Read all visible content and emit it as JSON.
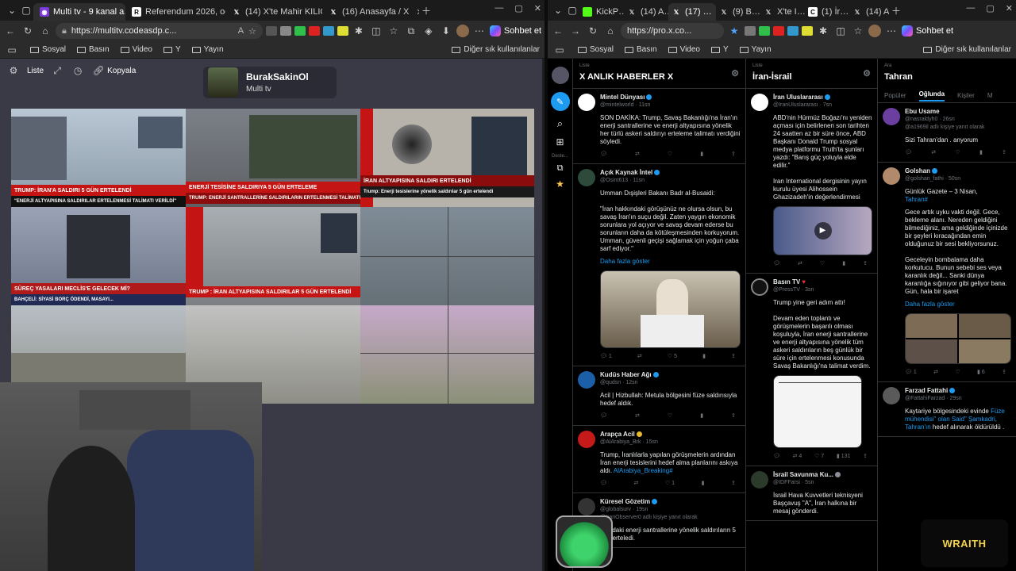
{
  "left_window": {
    "tabs": [
      {
        "title": "Multi tv - 9 kanal a…",
        "active": true
      },
      {
        "title": "Referendum 2026, ogg…",
        "active": false
      },
      {
        "title": "(14) X'te Mahir KILIÇ: \"…",
        "active": false
      },
      {
        "title": "(16) Anasayfa / X",
        "active": false
      }
    ],
    "url": "https://multitv.codeasdp.c...",
    "chat_label": "Sohbet et",
    "bookmarks": [
      "Sosyal",
      "Basın",
      "Video",
      "Y",
      "Yayın"
    ],
    "bookmarks_right": "Diğer sık kullanılanlar",
    "toolbar": {
      "list_label": "Liste",
      "copy_label": "Kopyala"
    },
    "profile": {
      "name": "BurakSakinOl",
      "subtitle": "Multi tv"
    },
    "channels": [
      {
        "banner": "TRUMP: İRAN'A SALDIRI 5 GÜN ERTELENDİ",
        "sub": "\"ENERJİ ALTYAPISINA SALDIRILAR ERTELENMESİ TALİMATI VERİLDİ\"",
        "bg": "#c41414",
        "tag": "SON DAKİKA"
      },
      {
        "banner": "ENERJİ TESİSİNE SALDIRIYA 5 GÜN ERTELEME",
        "sub": "TRUMP: ENERJİ SANTRALLERİNE SALDIRILARIN ERTELENMESİ TALİMATI VERDİM",
        "bg": "#c41414",
        "tag": "SON DAKİKA"
      },
      {
        "banner": "İRAN ALTYAPISINA SALDIRI ERTELENDİ",
        "sub": "Trump: Enerji tesislerine yönelik saldırılar 5 gün ertelendi",
        "bg": "#8a0c0c",
        "tag": "SON DAKİKA"
      },
      {
        "banner": "SÜREÇ YASALARI MECLİS'E GELECEK Mİ?",
        "sub": "BAHÇELİ: SİYASİ BORÇ ÖDENDİ, MASAYI...",
        "bg": "#b01a1a",
        "tag": ""
      },
      {
        "banner": "TRUMP : İRAN ALTYAPISINA SALDIRILAR 5 GÜN ERTELENDİ",
        "sub": "",
        "bg": "#c41414",
        "tag": "SON DAKİKA"
      },
      {
        "banner": "",
        "sub": "",
        "bg": "#777",
        "tag": ""
      },
      {
        "banner": "",
        "sub": "",
        "bg": "#777",
        "tag": ""
      },
      {
        "banner": "",
        "sub": "",
        "bg": "#777",
        "tag": ""
      },
      {
        "banner": "",
        "sub": "",
        "bg": "#777",
        "tag": ""
      }
    ]
  },
  "right_window": {
    "tabs": [
      "KickP…",
      "(14) A…",
      "(17) …",
      "(9) B…",
      "X'te I…",
      "(1) İr…",
      "(14) A…"
    ],
    "url": "https://pro.x.co...",
    "chat_label": "Sohbet et",
    "bookmarks": [
      "Sosyal",
      "Basın",
      "Video",
      "Y",
      "Yayın"
    ],
    "bookmarks_right": "Diğer sık kullanılanlar",
    "sidebar_label": "Deste...",
    "col1": {
      "label": "Liste",
      "title": "X ANLIK HABERLER X",
      "tweets": [
        {
          "name": "Mintel Dünyası",
          "handle": "@mintelworld · 11sn",
          "text": "SON DAKİKA: Trump, Savaş Bakanlığı'na İran'ın enerji santrallerine ve enerji altyapısına yönelik her türlü askeri saldırıyı erteleme talimatı verdiğini söyledi.",
          "stats": [
            "",
            "",
            "",
            ""
          ]
        },
        {
          "name": "Açık Kaynak İntel",
          "handle": "@Osint613 · 11sn",
          "text": "Umman Dışişleri Bakanı Badr al-Busaidi:\n\n\"İran hakkındaki görüşünüz ne olursa olsun, bu savaş İran'ın suçu değil. Zaten yaygın ekonomik sorunlara yol açıyor ve savaş devam ederse bu sorunların daha da kötüleşmesinden korkuyorum. Umman, güvenli geçişi sağlamak için yoğun çaba sarf ediyor.\"",
          "more": "Daha fazla göster",
          "stats": [
            "1",
            "",
            "5",
            ""
          ]
        },
        {
          "name": "Kudüs Haber Ağı",
          "handle": "@qudsn · 12sn",
          "text": "Acil | Hizbullah: Metula bölgesini füze saldırısıyla hedef aldık.",
          "stats": [
            "",
            "",
            "",
            ""
          ]
        },
        {
          "name": "Arapça Acil",
          "handle": "@AlArabiya_Brk · 15sn",
          "text": "Trump, İranlılarla yapılan görüşmelerin ardından İran enerji tesislerini hedef alma planlarını askıya aldı.",
          "link": "AlArabiya_Breaking#",
          "stats": [
            "",
            "",
            "1",
            ""
          ]
        },
        {
          "name": "Küresel Gözetim",
          "handle": "@globalsurv · 19sn",
          "text": "İran'daki enerji santrallerine yönelik saldırıların 5 gün erteledi.",
          "reply": "@IranObserver0 adlı kişiye yanıt olarak",
          "stats": [
            "",
            "",
            "",
            ""
          ]
        }
      ]
    },
    "col2": {
      "label": "Liste",
      "title": "İran-İsrail",
      "tweets": [
        {
          "name": "İran Uluslararası",
          "handle": "@IranUluslararası · 7sn",
          "text": "ABD'nin Hürmüz Boğazı'nı yeniden açması için belirlenen son tarihten 24 saatten az bir süre önce, ABD Başkanı Donald Trump sosyal medya platformu Truth'ta şunları yazdı: \"Barış güç yoluyla elde edilir.\"\n\nIran International dergisinin yayın kurulu üyesi Alihossein Ghazizadeh'in değerlendirmesi",
          "stats": [
            "",
            "",
            "",
            ""
          ]
        },
        {
          "name": "Basın TV",
          "handle": "@PressTV · 3sn",
          "text": "Trump yine geri adım attı!\n\nDevam eden toplantı ve görüşmelerin başarılı olması koşuluyla, İran enerji santrallerine ve enerji altyapısına yönelik tüm askeri saldırıların beş günlük bir süre için ertelenmesi konusunda Savaş Bakanlığı'na talimat verdim.",
          "stats": [
            "4",
            "7",
            "131",
            ""
          ]
        },
        {
          "name": "İsrail Savunma Ku...",
          "handle": "@IDFFarsi · 5sn",
          "text": "İsrail Hava Kuvvetleri teknisyeni Başçavuş \"A\", İran halkına bir mesaj gönderdi.",
          "stats": []
        }
      ]
    },
    "col3": {
      "label": "Ara",
      "title": "Tahran",
      "tabs": [
        "Popüler",
        "Oğlunda",
        "Kişiler",
        "M"
      ],
      "tweets": [
        {
          "name": "Ebu Usame",
          "handle": "@nasraldyh0 · 26sn",
          "reply": "@a1969il adlı kişiye yanıt olarak",
          "text": "Sizi Tahran'dan . anyorum",
          "stats": [
            "",
            "",
            "",
            ""
          ]
        },
        {
          "name": "Golshan",
          "handle": "@golshan_fathi · 50sn",
          "text": "Günlük Gazete – 3 Nisan,",
          "tag": "Tahran#",
          "text2": "Gece artık uyku vakti değil. Gece, bekleme alanı. Nereden geldiğini bilmediğiniz, ama geldiğinde içinizde bir şeyleri kıracağından emin olduğunuz bir sesi bekliyorsunuz.\n\nGeceleyin bombalama daha korkutucu. Bunun sebebi ses veya karanlık değil... Sanki dünya karanlığa sığınıyor gibi geliyor bana.\nGün, hala bir işaret",
          "more": "Daha fazla göster",
          "stats": [
            "1",
            "",
            "",
            "6"
          ]
        },
        {
          "name": "Farzad Fattahi",
          "handle": "@FattahiFarzad · 29sn",
          "text": "Kaytariye bölgesindeki evinde",
          "blue_text": "Füze mühendisi\" olan Said\" Şamkadri, Tahran'ın",
          "text3": "hedef alınarak öldürüldü .",
          "stats": []
        }
      ]
    }
  },
  "overlay": {
    "wraith_label": "WRAITH"
  }
}
